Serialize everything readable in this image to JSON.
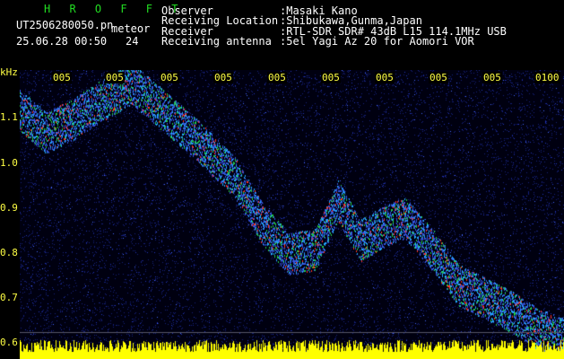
{
  "header": {
    "app_name": "H R O F F T",
    "filename": "UT2506280050.pn",
    "type_label": "meteor",
    "datetime": "25.06.28 00:50",
    "count": "24",
    "info_labels": [
      "Observer",
      "Receiving Location",
      "Receiver",
      "Receiving antenna"
    ],
    "info_values": [
      ":Masaki Kano",
      ":Shibukawa,Gunma,Japan",
      ":RTL-SDR SDR# 43dB L15 114.1MHz USB",
      ":5el Yagi Az 20 for Aomori VOR"
    ]
  },
  "plot": {
    "y_unit": "kHz",
    "y_ticks": [
      "1.1",
      "1.0",
      "0.9",
      "0.8",
      "0.7",
      "0.6"
    ],
    "x_ticks": [
      "005",
      "005",
      "005",
      "005",
      "005",
      "005",
      "005",
      "005",
      "005",
      "0100"
    ],
    "colors": {
      "background": "#000010",
      "noise": "#1a2a8a",
      "signal_hot": "#ff2222",
      "signal_mid": "#22cc44",
      "signal_cool": "#22aaff",
      "baseline": "#ffff00",
      "axis_text": "#ffff44"
    }
  }
}
